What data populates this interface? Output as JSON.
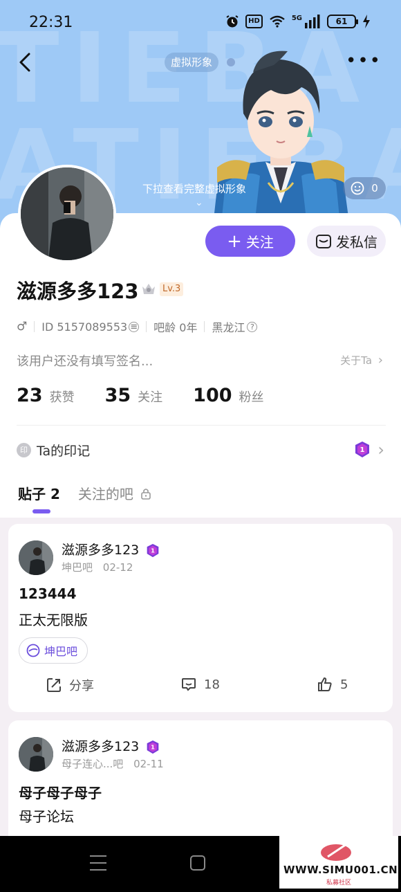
{
  "status_bar": {
    "time": "22:31",
    "hd": "HD",
    "network": "5G",
    "battery": "61"
  },
  "header": {
    "avatar_tag": "虚拟形象",
    "pull_hint": "下拉查看完整虚拟形象",
    "emoji_count": "0",
    "banner_letters": [
      "TIEBA",
      "ATIEBA"
    ]
  },
  "profile": {
    "username": "滋源多多123",
    "level": "Lv.3",
    "gender_icon": "male-icon",
    "id_text": "ID 5157089553",
    "bar_age": "吧龄 0年",
    "location": "黑龙江",
    "signature": "该用户还没有填写签名...",
    "about_link": "关于Ta",
    "follow_label": "关注",
    "message_label": "发私信"
  },
  "stats": [
    {
      "num": "23",
      "label": "获赞"
    },
    {
      "num": "35",
      "label": "关注"
    },
    {
      "num": "100",
      "label": "粉丝"
    }
  ],
  "imprint": {
    "icon_text": "印",
    "label": "Ta的印记"
  },
  "tabs": {
    "active": "贴子 2",
    "inactive": "关注的吧"
  },
  "posts": [
    {
      "author": "滋源多多123",
      "forum": "坤巴吧",
      "date": "02-12",
      "title": "123444",
      "body": "正太无限版",
      "chip": "坤巴吧",
      "share_label": "分享",
      "comments": "18",
      "likes": "5"
    },
    {
      "author": "滋源多多123",
      "forum": "母子连心...吧",
      "date": "02-11",
      "title": "母子母子母子",
      "body": "母子论坛"
    }
  ],
  "watermark": {
    "text": "WWW.SIMU001.CN",
    "sub": "私募社区"
  },
  "colors": {
    "accent": "#7a5cf0",
    "banner": "#9ec9f6",
    "background": "#f4eff4"
  }
}
